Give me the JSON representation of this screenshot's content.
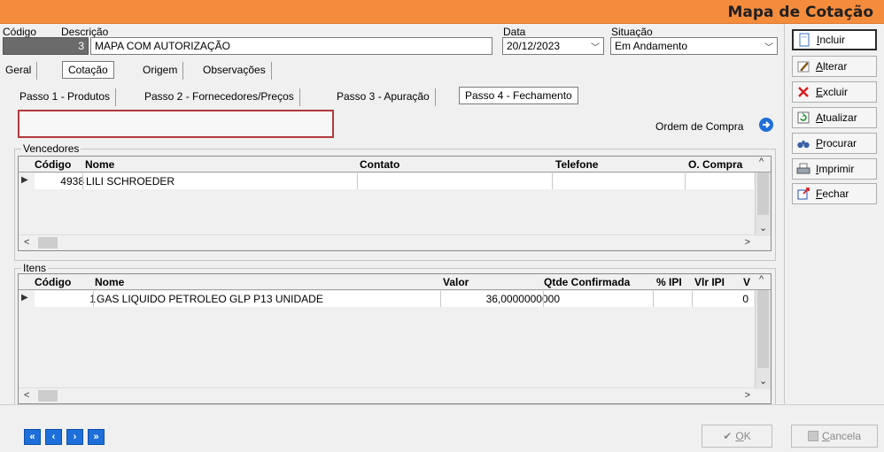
{
  "window": {
    "title": "Mapa de Cotação"
  },
  "header": {
    "codigo_label": "Código",
    "codigo_value": "3",
    "descricao_label": "Descrição",
    "descricao_value": "MAPA COM AUTORIZAÇÃO",
    "data_label": "Data",
    "data_value": "20/12/2023",
    "situacao_label": "Situação",
    "situacao_value": "Em Andamento"
  },
  "tabs": [
    "Geral",
    "Cotação",
    "Origem",
    "Observações"
  ],
  "active_tab": "Cotação",
  "steps": [
    "Passo 1 - Produtos",
    "Passo 2 - Fornecedores/Preços",
    "Passo 3 - Apuração",
    "Passo 4 - Fechamento"
  ],
  "active_step": "Passo 4 - Fechamento",
  "ordem_compra_label": "Ordem de Compra",
  "vencedores": {
    "title": "Vencedores",
    "columns": [
      "Código",
      "Nome",
      "Contato",
      "Telefone",
      "O. Compra"
    ],
    "rows": [
      {
        "codigo": "4938",
        "nome": "LILI SCHROEDER",
        "contato": "",
        "telefone": "",
        "ocompra": ""
      }
    ]
  },
  "itens": {
    "title": "Itens",
    "columns": [
      "Código",
      "Nome",
      "Valor",
      "Qtde Confirmada",
      "% IPI",
      "Vlr IPI",
      "V"
    ],
    "rows": [
      {
        "codigo": "1",
        "nome": "GAS LIQUIDO PETROLEO GLP P13 UNIDADE",
        "valor": "36,0000000000",
        "qtde": "",
        "ipi": "",
        "vlr_ipi": "0"
      }
    ]
  },
  "side_buttons": {
    "incluir": {
      "u": "I",
      "rest": "ncluir"
    },
    "alterar": {
      "u": "A",
      "rest": "lterar"
    },
    "excluir": {
      "u": "E",
      "rest": "xcluir"
    },
    "atualizar": {
      "u": "A",
      "rest": "tualizar"
    },
    "procurar": {
      "u": "P",
      "rest": "rocurar"
    },
    "imprimir": {
      "u": "I",
      "rest": "mprimir"
    },
    "fechar": {
      "u": "F",
      "rest": "echar"
    }
  },
  "footer": {
    "nav": [
      "«",
      "‹",
      "›",
      "»"
    ],
    "ok": {
      "u": "O",
      "rest": "K"
    },
    "cancela": {
      "u": "C",
      "rest": "ancela"
    }
  },
  "colors": {
    "titlebar": "#f58c3c",
    "nav_blue": "#1e6fd9"
  },
  "icons": [
    "document-icon",
    "pencil-icon",
    "red-x-icon",
    "refresh-icon",
    "binoculars-icon",
    "printer-icon",
    "exit-icon",
    "blue-arrow-icon",
    "checkmark-icon"
  ]
}
